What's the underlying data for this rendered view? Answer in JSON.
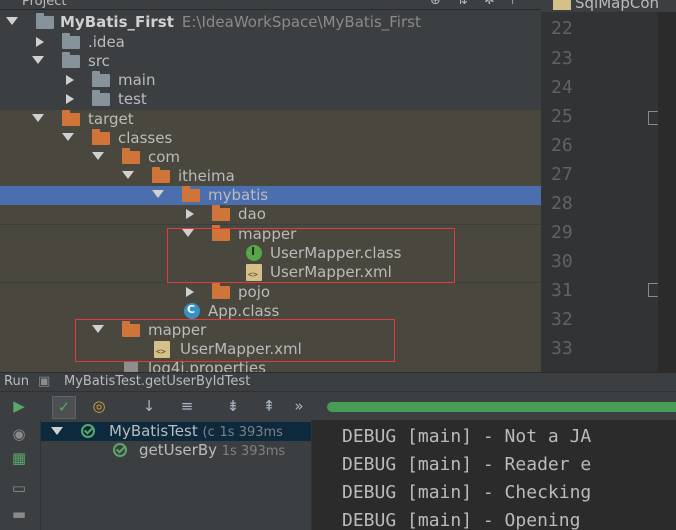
{
  "project_panel": {
    "title": "Project",
    "root": {
      "name": "MyBatis_First",
      "path": "E:\\IdeaWorkSpace\\MyBatis_First"
    },
    "tree": [
      {
        "label": ".idea"
      },
      {
        "label": "src"
      },
      {
        "label": "main"
      },
      {
        "label": "test"
      },
      {
        "label": "target"
      },
      {
        "label": "classes"
      },
      {
        "label": "com"
      },
      {
        "label": "itheima"
      },
      {
        "label": "mybatis"
      },
      {
        "label": "dao"
      },
      {
        "label": "mapper"
      },
      {
        "label": "UserMapper.class"
      },
      {
        "label": "UserMapper.xml"
      },
      {
        "label": "pojo"
      },
      {
        "label": "App.class"
      },
      {
        "label": "mapper"
      },
      {
        "label": "UserMapper.xml"
      },
      {
        "label": "log4j.properties"
      }
    ],
    "highlight_color": "#e03c3c"
  },
  "editor": {
    "tab_label": "SqlMapCon",
    "line_numbers": [
      "22",
      "23",
      "24",
      "25",
      "26",
      "27",
      "28",
      "29",
      "30",
      "31",
      "32",
      "33"
    ]
  },
  "run_panel": {
    "label": "Run",
    "config_name": "MyBatisTest.getUserByIdTest",
    "toolbar_more": "»",
    "progress": 1.0,
    "tests": [
      {
        "name": "MyBatisTest",
        "suffix": "(c",
        "duration": "1s 393ms"
      },
      {
        "name": "getUserBy",
        "duration": "1s 393ms"
      }
    ],
    "console": [
      "DEBUG [main] - Not a JA",
      "DEBUG [main] - Reader e",
      "DEBUG [main] - Checking",
      "DEBUG [main] - Opening "
    ]
  },
  "colors": {
    "selection": "#4b6eaf",
    "passed": "#59a869",
    "accent_folder": "#d0753a"
  }
}
